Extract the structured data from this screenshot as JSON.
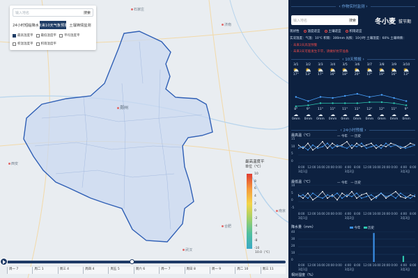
{
  "map": {
    "search_placeholder": "输入地名",
    "search_button": "搜索",
    "tabs": [
      "24小时短临降水",
      "未来10天气象预报",
      "土壤墒情监测"
    ],
    "active_tab": 1,
    "checkboxes": [
      "最高温度平",
      "最低温度平",
      "平均温度平",
      "积温温度平",
      "积雨温度平"
    ],
    "checked": [
      true,
      false,
      false,
      false,
      false
    ],
    "capital": "郑州",
    "cities": [
      "济南",
      "合肥",
      "南京",
      "太原",
      "石家庄",
      "西安",
      "武汉"
    ],
    "legend": {
      "title": "最高温度平",
      "subtitle": "单位（℃）",
      "ticks": [
        "10",
        "8",
        "6",
        "4",
        "2",
        "0",
        "-2",
        "-4",
        "-6",
        "-8",
        "-10"
      ],
      "unit": "10.0（℃）"
    },
    "timeline": {
      "days": [
        "周一 7",
        "周二 1",
        "周三 4",
        "周四 4",
        "周五 5",
        "周六 6",
        "周一 7",
        "周日 8",
        "周一 9",
        "周二 10",
        "周三 11"
      ],
      "progress": 0.45
    },
    "colors": {
      "region_fill": "#c9d8f0",
      "region_border": "#2f5fb5",
      "panel_bg": "#0d2140"
    }
  },
  "panel": {
    "title": "作物实时监测",
    "search_placeholder": "输入地名",
    "search_button": "搜索",
    "crop": "冬小麦",
    "stage": "拔节期",
    "status_items": [
      "现状性",
      "温度适宜",
      "土壤适宜",
      "积雨适宜"
    ],
    "weather_row": "实况温度：气温：10℃  积雨：300mm  光照：10小时  土壤湿度：60%  土壤墒情：",
    "warn1": "· 未来3天高温预警",
    "warn2": "· 未来3天可能发生干旱，请做好抗旱准备",
    "forecast_title": "10天预报",
    "forecast": {
      "dates": [
        "3/1",
        "3/2",
        "3/3",
        "3/4",
        "3/5",
        "3/6",
        "3/7",
        "3/8",
        "3/9",
        "3/10"
      ],
      "highs": [
        17,
        13,
        17,
        16,
        18,
        20,
        17,
        19,
        16,
        13
      ],
      "lows": [
        8,
        9,
        11,
        11,
        11,
        11,
        12,
        12,
        11,
        9
      ],
      "rain": [
        "0mm",
        "0mm",
        "0mm",
        "0mm",
        "0mm",
        "0mm",
        "0mm",
        "0mm",
        "0mm",
        "0mm"
      ]
    },
    "hour24_title": "24小时预报",
    "max_temp_label": "最高温（℃）",
    "min_temp_label": "最低温（℃）",
    "rain_label": "降水量（mm）",
    "humidity_label": "相对湿度（%）",
    "legend_today": "今年",
    "legend_hist": "历史",
    "x_times": [
      "8:00",
      "12:00",
      "16:00",
      "20:00",
      "0:00",
      "4:00",
      "8:00",
      "12:00",
      "16:00",
      "20:00",
      "0:00",
      "4:00",
      "8:00"
    ],
    "x_dates": [
      "3月1日",
      "3月2日",
      "3月3日"
    ],
    "max_axis": [
      "15",
      "10",
      "5",
      "0"
    ],
    "min_axis": [
      "10",
      "5",
      "0",
      "-5"
    ],
    "rain_axis": [
      "40",
      "30",
      "20",
      "10",
      "0"
    ],
    "max_today": [
      11,
      9,
      12,
      8,
      10,
      13,
      9,
      12,
      10,
      11,
      13,
      9,
      12,
      10,
      11,
      12,
      9,
      11,
      10,
      12,
      11,
      9,
      10,
      12,
      11
    ],
    "max_hist": [
      9,
      10,
      8,
      11,
      9,
      10,
      12,
      9,
      11,
      10,
      9,
      11,
      10,
      12,
      9,
      10,
      11,
      9,
      12,
      10,
      11,
      10,
      9,
      10,
      11
    ],
    "min_today": [
      4,
      2,
      5,
      1,
      3,
      6,
      2,
      4,
      1,
      5,
      3,
      6,
      2,
      4,
      5,
      1,
      3,
      5,
      2,
      4,
      6,
      3,
      2,
      4,
      3
    ],
    "min_hist": [
      3,
      4,
      2,
      5,
      3,
      2,
      4,
      3,
      5,
      2,
      4,
      3,
      5,
      2,
      3,
      4,
      2,
      5,
      3,
      4,
      2,
      5,
      3,
      2,
      4
    ],
    "rain_today": [
      0,
      0,
      0,
      0,
      0,
      0,
      0,
      0,
      0,
      0,
      0,
      0,
      0,
      0,
      0,
      0,
      38,
      0,
      0,
      0,
      0,
      0,
      0,
      0,
      0
    ],
    "rain_hist": [
      0,
      0,
      0,
      0,
      0,
      0,
      0,
      0,
      0,
      0,
      0,
      0,
      0,
      0,
      0,
      0,
      0,
      0,
      0,
      0,
      0,
      0,
      8,
      0,
      0
    ]
  }
}
